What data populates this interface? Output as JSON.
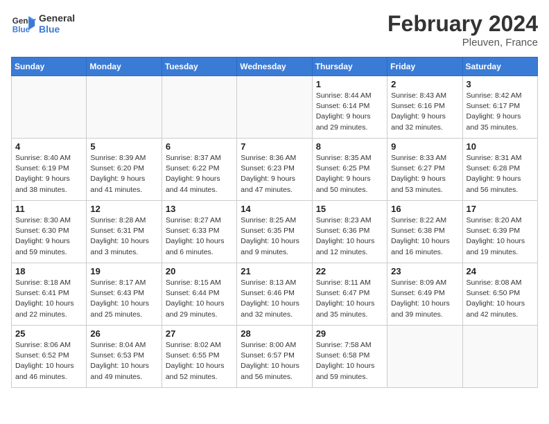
{
  "logo": {
    "line1": "General",
    "line2": "Blue"
  },
  "title": "February 2024",
  "location": "Pleuven, France",
  "days_of_week": [
    "Sunday",
    "Monday",
    "Tuesday",
    "Wednesday",
    "Thursday",
    "Friday",
    "Saturday"
  ],
  "weeks": [
    [
      {
        "day": "",
        "info": ""
      },
      {
        "day": "",
        "info": ""
      },
      {
        "day": "",
        "info": ""
      },
      {
        "day": "",
        "info": ""
      },
      {
        "day": "1",
        "info": "Sunrise: 8:44 AM\nSunset: 6:14 PM\nDaylight: 9 hours\nand 29 minutes."
      },
      {
        "day": "2",
        "info": "Sunrise: 8:43 AM\nSunset: 6:16 PM\nDaylight: 9 hours\nand 32 minutes."
      },
      {
        "day": "3",
        "info": "Sunrise: 8:42 AM\nSunset: 6:17 PM\nDaylight: 9 hours\nand 35 minutes."
      }
    ],
    [
      {
        "day": "4",
        "info": "Sunrise: 8:40 AM\nSunset: 6:19 PM\nDaylight: 9 hours\nand 38 minutes."
      },
      {
        "day": "5",
        "info": "Sunrise: 8:39 AM\nSunset: 6:20 PM\nDaylight: 9 hours\nand 41 minutes."
      },
      {
        "day": "6",
        "info": "Sunrise: 8:37 AM\nSunset: 6:22 PM\nDaylight: 9 hours\nand 44 minutes."
      },
      {
        "day": "7",
        "info": "Sunrise: 8:36 AM\nSunset: 6:23 PM\nDaylight: 9 hours\nand 47 minutes."
      },
      {
        "day": "8",
        "info": "Sunrise: 8:35 AM\nSunset: 6:25 PM\nDaylight: 9 hours\nand 50 minutes."
      },
      {
        "day": "9",
        "info": "Sunrise: 8:33 AM\nSunset: 6:27 PM\nDaylight: 9 hours\nand 53 minutes."
      },
      {
        "day": "10",
        "info": "Sunrise: 8:31 AM\nSunset: 6:28 PM\nDaylight: 9 hours\nand 56 minutes."
      }
    ],
    [
      {
        "day": "11",
        "info": "Sunrise: 8:30 AM\nSunset: 6:30 PM\nDaylight: 9 hours\nand 59 minutes."
      },
      {
        "day": "12",
        "info": "Sunrise: 8:28 AM\nSunset: 6:31 PM\nDaylight: 10 hours\nand 3 minutes."
      },
      {
        "day": "13",
        "info": "Sunrise: 8:27 AM\nSunset: 6:33 PM\nDaylight: 10 hours\nand 6 minutes."
      },
      {
        "day": "14",
        "info": "Sunrise: 8:25 AM\nSunset: 6:35 PM\nDaylight: 10 hours\nand 9 minutes."
      },
      {
        "day": "15",
        "info": "Sunrise: 8:23 AM\nSunset: 6:36 PM\nDaylight: 10 hours\nand 12 minutes."
      },
      {
        "day": "16",
        "info": "Sunrise: 8:22 AM\nSunset: 6:38 PM\nDaylight: 10 hours\nand 16 minutes."
      },
      {
        "day": "17",
        "info": "Sunrise: 8:20 AM\nSunset: 6:39 PM\nDaylight: 10 hours\nand 19 minutes."
      }
    ],
    [
      {
        "day": "18",
        "info": "Sunrise: 8:18 AM\nSunset: 6:41 PM\nDaylight: 10 hours\nand 22 minutes."
      },
      {
        "day": "19",
        "info": "Sunrise: 8:17 AM\nSunset: 6:43 PM\nDaylight: 10 hours\nand 25 minutes."
      },
      {
        "day": "20",
        "info": "Sunrise: 8:15 AM\nSunset: 6:44 PM\nDaylight: 10 hours\nand 29 minutes."
      },
      {
        "day": "21",
        "info": "Sunrise: 8:13 AM\nSunset: 6:46 PM\nDaylight: 10 hours\nand 32 minutes."
      },
      {
        "day": "22",
        "info": "Sunrise: 8:11 AM\nSunset: 6:47 PM\nDaylight: 10 hours\nand 35 minutes."
      },
      {
        "day": "23",
        "info": "Sunrise: 8:09 AM\nSunset: 6:49 PM\nDaylight: 10 hours\nand 39 minutes."
      },
      {
        "day": "24",
        "info": "Sunrise: 8:08 AM\nSunset: 6:50 PM\nDaylight: 10 hours\nand 42 minutes."
      }
    ],
    [
      {
        "day": "25",
        "info": "Sunrise: 8:06 AM\nSunset: 6:52 PM\nDaylight: 10 hours\nand 46 minutes."
      },
      {
        "day": "26",
        "info": "Sunrise: 8:04 AM\nSunset: 6:53 PM\nDaylight: 10 hours\nand 49 minutes."
      },
      {
        "day": "27",
        "info": "Sunrise: 8:02 AM\nSunset: 6:55 PM\nDaylight: 10 hours\nand 52 minutes."
      },
      {
        "day": "28",
        "info": "Sunrise: 8:00 AM\nSunset: 6:57 PM\nDaylight: 10 hours\nand 56 minutes."
      },
      {
        "day": "29",
        "info": "Sunrise: 7:58 AM\nSunset: 6:58 PM\nDaylight: 10 hours\nand 59 minutes."
      },
      {
        "day": "",
        "info": ""
      },
      {
        "day": "",
        "info": ""
      }
    ]
  ]
}
